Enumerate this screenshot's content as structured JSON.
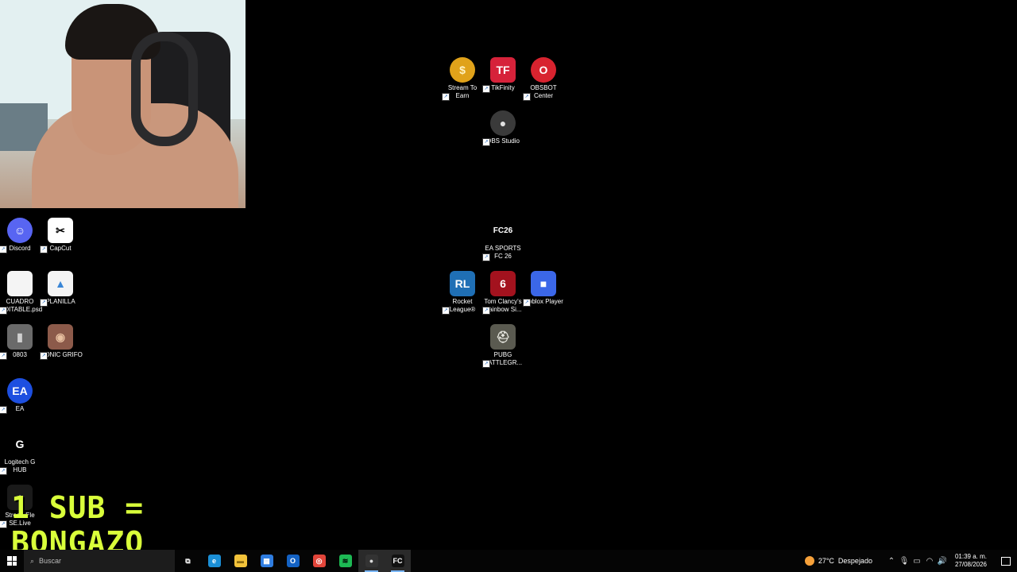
{
  "desktop": {
    "icons": [
      {
        "id": "stream-to-earn",
        "line1": "Stream To",
        "line2": "Earn",
        "glyph": "$",
        "bg": "#e0a21a",
        "fg": "#fff3c4"
      },
      {
        "id": "tikfinity",
        "line1": "TikFinity",
        "line2": "",
        "glyph": "TF",
        "bg": "#d6223a",
        "fg": "#ffffff"
      },
      {
        "id": "obsbot-center",
        "line1": "OBSBOT",
        "line2": "Center",
        "glyph": "O",
        "bg": "#d8232f",
        "fg": "#ffffff"
      },
      {
        "id": "obs-studio",
        "line1": "OBS Studio",
        "line2": "",
        "glyph": "●",
        "bg": "#3a3a3a",
        "fg": "#e0e0e0"
      },
      {
        "id": "ea-sports-fc",
        "line1": "EA SPORTS",
        "line2": "FC 26",
        "glyph": "FC26",
        "bg": "#000000",
        "fg": "#ffffff"
      },
      {
        "id": "rocket-league",
        "line1": "Rocket",
        "line2": "League®",
        "glyph": "RL",
        "bg": "#1f6fb5",
        "fg": "#ffffff"
      },
      {
        "id": "rainbow-six",
        "line1": "Tom Clancy's",
        "line2": "Rainbow Si...",
        "glyph": "6",
        "bg": "#a3121e",
        "fg": "#ffffff"
      },
      {
        "id": "roblox-player",
        "line1": "Roblox Player",
        "line2": "",
        "glyph": "■",
        "bg": "#3b67e8",
        "fg": "#ffffff"
      },
      {
        "id": "pubg",
        "line1": "PUBG",
        "line2": "BATTLEGR...",
        "glyph": "⛑",
        "bg": "#5a5a50",
        "fg": "#e7e7e0"
      },
      {
        "id": "discord",
        "line1": "Discord",
        "line2": "",
        "glyph": "☺",
        "bg": "#5865f2",
        "fg": "#ffffff"
      },
      {
        "id": "capcut",
        "line1": "CapCut",
        "line2": "",
        "glyph": "✂",
        "bg": "#ffffff",
        "fg": "#000000"
      },
      {
        "id": "cuadro-editable",
        "line1": "CUADRO",
        "line2": "EDITABLE.psd",
        "glyph": "",
        "bg": "#f4f4f4",
        "fg": "#999"
      },
      {
        "id": "planilla",
        "line1": "PLANILLA",
        "line2": "",
        "glyph": "▲",
        "bg": "#f4f4f4",
        "fg": "#3a86d6"
      },
      {
        "id": "video-0803",
        "line1": "0803",
        "line2": "",
        "glyph": "▮",
        "bg": "#6a6a6a",
        "fg": "#cfcfcf"
      },
      {
        "id": "sonic-grifo",
        "line1": "SONIC GRIFO",
        "line2": "",
        "glyph": "◉",
        "bg": "#8c5a4a",
        "fg": "#e8c0a0"
      },
      {
        "id": "ea",
        "line1": "EA",
        "line2": "",
        "glyph": "EA",
        "bg": "#1d4fe0",
        "fg": "#ffffff"
      },
      {
        "id": "logitech-ghub",
        "line1": "Logitech G",
        "line2": "HUB",
        "glyph": "G",
        "bg": "#000000",
        "fg": "#ffffff"
      },
      {
        "id": "streamelements",
        "line1": "StreamEle",
        "line2": "SE.Live",
        "glyph": "▲",
        "bg": "#1a1a1a",
        "fg": "#ffffff"
      }
    ]
  },
  "overlay": {
    "line1": "1 SUB =",
    "line2": "BONGAZO"
  },
  "taskbar": {
    "search_placeholder": "Buscar",
    "weather_temp": "27°C",
    "weather_text": "Despejado",
    "time": "01:39 a. m.",
    "date": "27/08/2026",
    "apps": [
      {
        "name": "task-view-icon",
        "glyph": "⧉",
        "bg": "transparent",
        "fg": "#fff"
      },
      {
        "name": "edge-icon",
        "glyph": "e",
        "bg": "#1b8fd6",
        "fg": "#fff"
      },
      {
        "name": "file-explorer-icon",
        "glyph": "▬",
        "bg": "#f2c23a",
        "fg": "#8a6a10"
      },
      {
        "name": "microsoft-store-icon",
        "glyph": "▦",
        "bg": "#2f7de1",
        "fg": "#fff"
      },
      {
        "name": "outlook-icon",
        "glyph": "O",
        "bg": "#1462c4",
        "fg": "#fff"
      },
      {
        "name": "chrome-icon",
        "glyph": "◎",
        "bg": "#e2453a",
        "fg": "#fff"
      },
      {
        "name": "spotify-icon",
        "glyph": "≋",
        "bg": "#1db954",
        "fg": "#000"
      },
      {
        "name": "obs-taskbar-icon",
        "glyph": "●",
        "bg": "#333",
        "fg": "#ddd"
      },
      {
        "name": "fc26-taskbar-icon",
        "glyph": "FC",
        "bg": "#111",
        "fg": "#fff"
      }
    ]
  }
}
